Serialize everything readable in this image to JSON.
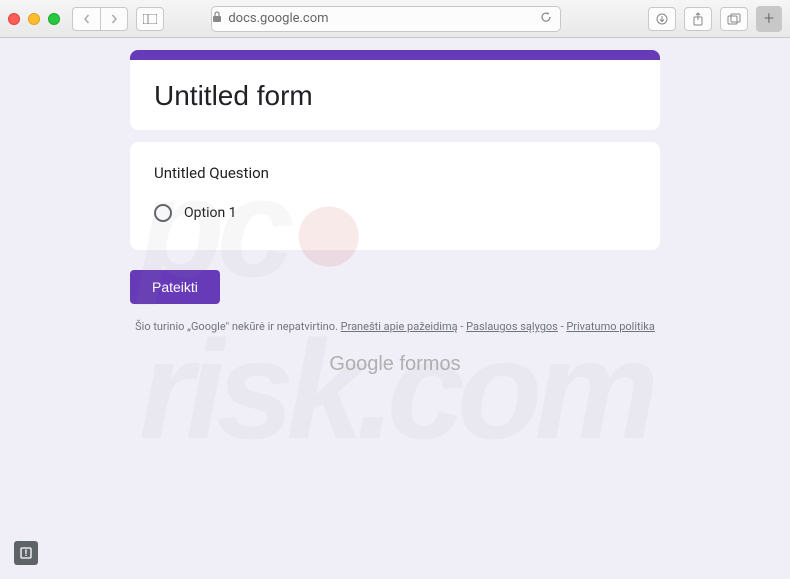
{
  "browser": {
    "url": "docs.google.com"
  },
  "form": {
    "title": "Untitled form",
    "question": {
      "title": "Untitled Question",
      "option1": "Option 1"
    },
    "submit_label": "Pateikti",
    "disclaimer": {
      "prefix": "Šio turinio „Google\" nekūrė ir nepatvirtino. ",
      "report": "Pranešti apie pažeidimą",
      "sep1": " - ",
      "terms": "Paslaugos sąlygos",
      "sep2": " - ",
      "privacy": "Privatumo politika"
    },
    "logo": {
      "google": "Google",
      "forms": " formos"
    }
  },
  "watermark": {
    "pc": "pc",
    "risk": "risk",
    "com": ".com"
  }
}
